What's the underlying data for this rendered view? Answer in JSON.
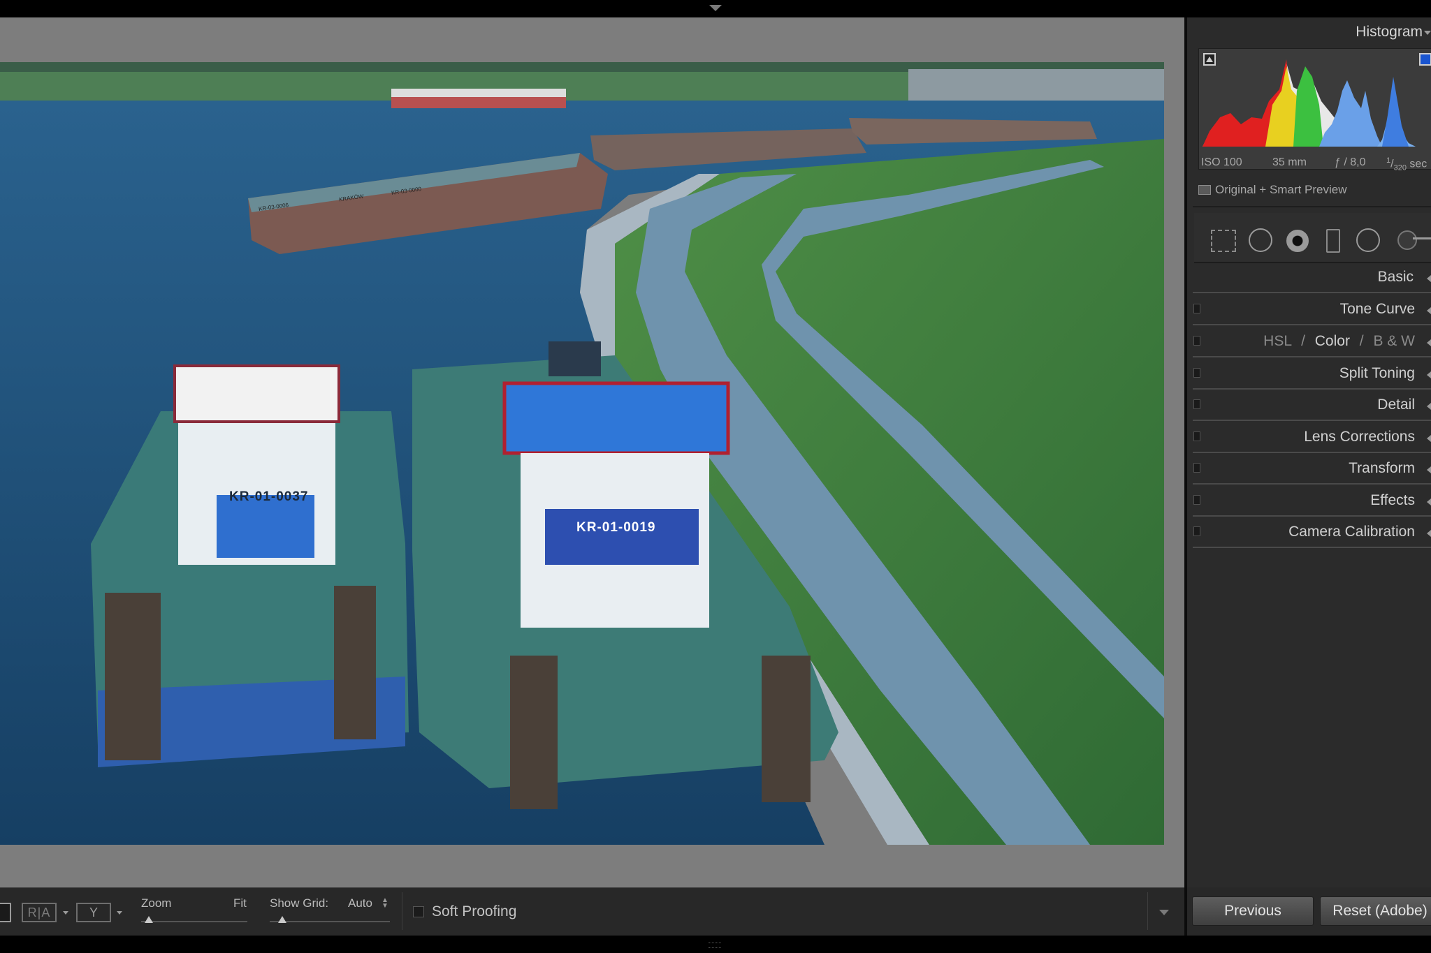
{
  "histogram": {
    "title": "Histogram",
    "iso": "ISO 100",
    "focal_length": "35 mm",
    "aperture": "ƒ / 8,0",
    "shutter_num": "1",
    "shutter_den": "320",
    "shutter_unit": "sec",
    "preview_label": "Original + Smart Preview"
  },
  "panels": [
    {
      "id": "basic",
      "label": "Basic"
    },
    {
      "id": "tone-curve",
      "label": "Tone Curve"
    },
    {
      "id": "hsl",
      "label": "",
      "hsl_parts": [
        "HSL",
        "/",
        "Color",
        "/",
        "B & W"
      ]
    },
    {
      "id": "split-toning",
      "label": "Split Toning"
    },
    {
      "id": "detail",
      "label": "Detail"
    },
    {
      "id": "lens-corrections",
      "label": "Lens Corrections"
    },
    {
      "id": "transform",
      "label": "Transform"
    },
    {
      "id": "effects",
      "label": "Effects"
    },
    {
      "id": "camera-calibration",
      "label": "Camera Calibration"
    }
  ],
  "toolbar": {
    "zoom_label": "Zoom",
    "zoom_value": "Fit",
    "grid_label": "Show Grid:",
    "grid_value": "Auto",
    "soft_proofing": "Soft Proofing",
    "view_mode_glyph": "R|A"
  },
  "footer": {
    "previous": "Previous",
    "reset": "Reset (Adobe)"
  },
  "photo": {
    "boat_left_id": "KR-01-0037",
    "boat_right_id": "KR-01-0019",
    "barge_label_1": "KR-03-0006",
    "barge_label_2": "KRAKÓW",
    "barge_label_3": "KR-03-0000"
  },
  "colors": {
    "panel_bg": "#2b2b2b",
    "canvas_bg": "#7d7d7d",
    "water": "#1e4f78",
    "grass": "#3e7a3a",
    "path": "#6b8fa8"
  }
}
